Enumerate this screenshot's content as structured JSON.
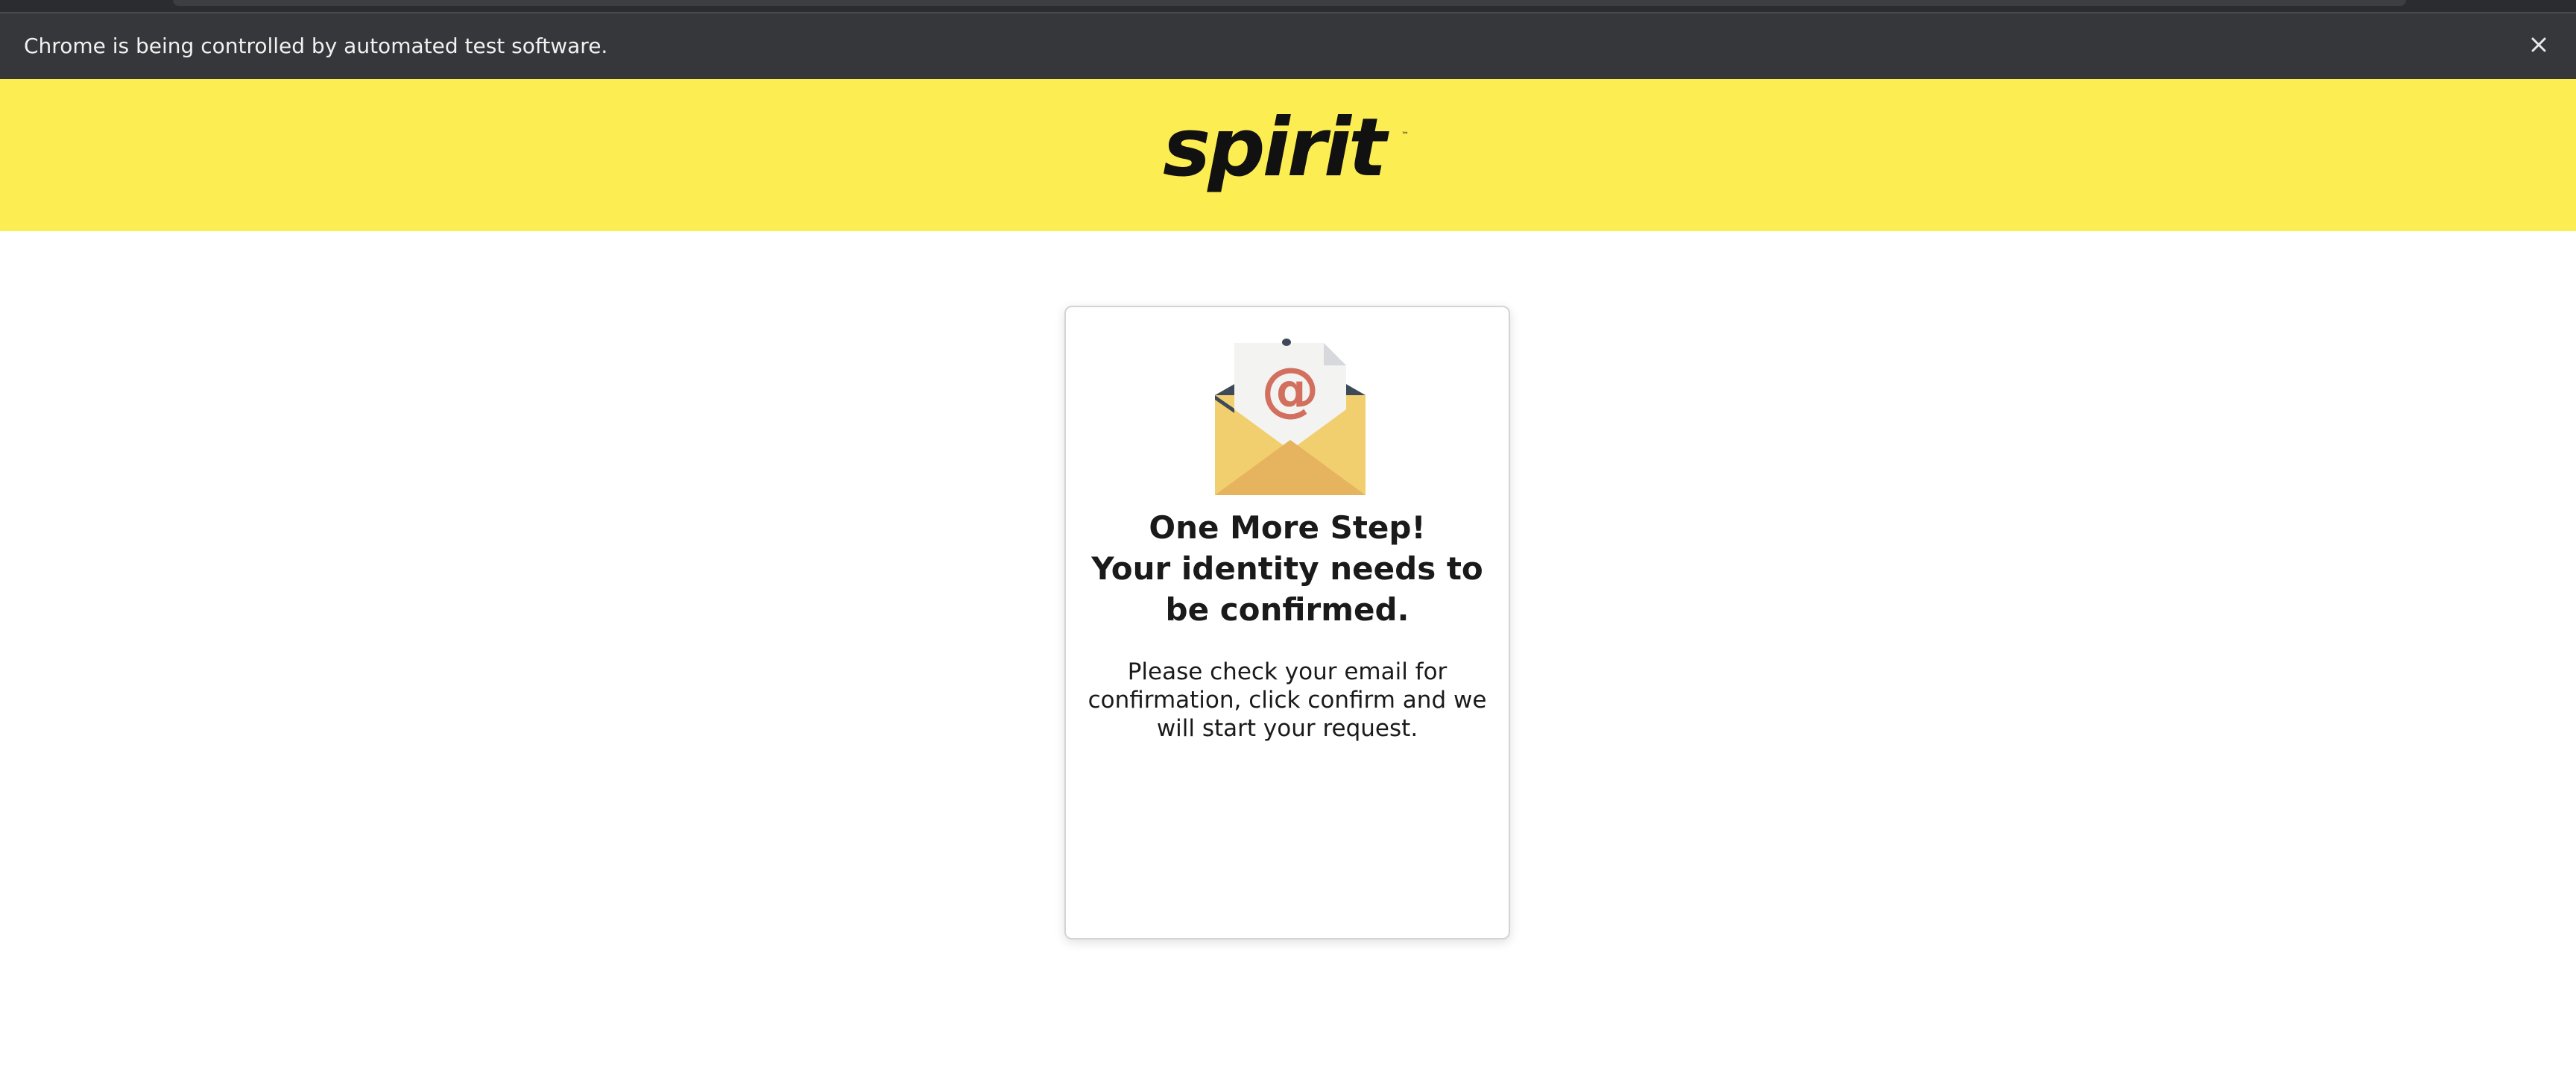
{
  "browser": {
    "automation_notice": "Chrome is being controlled by automated test software.",
    "close_icon": "close-icon"
  },
  "header": {
    "logo_text": "spirit",
    "background_color": "#fcee52"
  },
  "card": {
    "illustration_icon": "email-envelope-icon",
    "title_line1": "One More Step!",
    "title_line2": "Your identity needs to be confirmed.",
    "body": "Please check your email for confirmation, click confirm and we will start your request."
  }
}
